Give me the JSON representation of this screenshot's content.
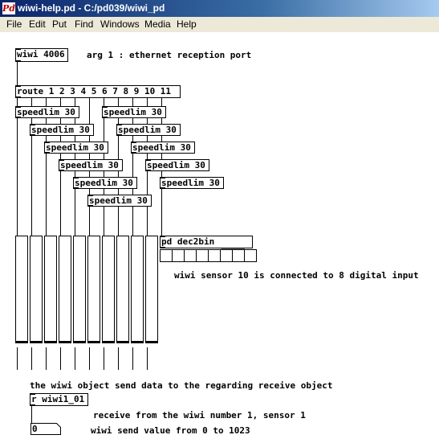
{
  "window": {
    "title": "wiwi-help.pd  - C:/pd039/wiwi_pd"
  },
  "menu": [
    "File",
    "Edit",
    "Put",
    "Find",
    "Windows",
    "Media",
    "Help"
  ],
  "objects": {
    "wiwi": "wiwi 4006",
    "route": "route 1 2 3 4 5 6 7 8 9 10 11",
    "speedlim": "speedlim 30",
    "dec2bin": "pd dec2bin",
    "receive": "r wiwi1_01"
  },
  "comments": {
    "arg": "arg 1 : ethernet reception port",
    "sensor10": "wiwi sensor 10 is connected to 8 digital input",
    "send": "the wiwi object send data to the regarding receive object",
    "receive_from": "receive from the wiwi number 1, sensor 1",
    "range": "wiwi send value from 0 to 1023"
  },
  "number_value": "0",
  "slider_count": 10,
  "toggle_count": 8
}
